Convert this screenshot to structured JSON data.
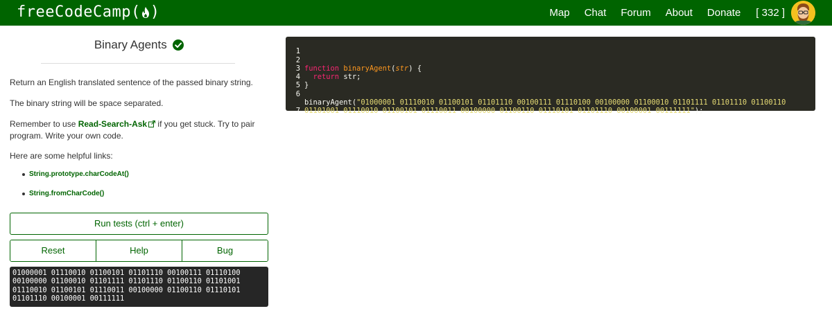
{
  "navbar": {
    "brand": "freeCodeCamp(",
    "brand_close": ")",
    "links": [
      "Map",
      "Chat",
      "Forum",
      "About",
      "Donate"
    ],
    "points": "[ 332 ]"
  },
  "challenge": {
    "title": "Binary Agents",
    "paragraphs": {
      "p1": "Return an English translated sentence of the passed binary string.",
      "p2": "The binary string will be space separated.",
      "p3_before": "Remember to use ",
      "p3_link": "Read-Search-Ask",
      "p3_after": " if you get stuck. Try to pair program. Write your own code.",
      "p4": "Here are some helpful links:"
    },
    "links": [
      "String.prototype.charCodeAt()",
      "String.fromCharCode()"
    ]
  },
  "buttons": {
    "run": "Run tests (ctrl + enter)",
    "reset": "Reset",
    "help": "Help",
    "bug": "Bug"
  },
  "output": {
    "lines": [
      "01000001 01110010 01100101 01101110 00100111 01110100",
      "00100000 01100010 01101111 01101110 01100110 01101001",
      "01110010 01100101 01110011 00100000 01100110 01110101",
      "01101110 00100001 00111111"
    ]
  },
  "editor": {
    "line_numbers": [
      "1",
      "2",
      "3",
      "4",
      "5",
      "6",
      "",
      "7"
    ],
    "line2": {
      "kw": "function",
      "fn": "binaryAgent",
      "open": "(",
      "param": "str",
      "close": ") {"
    },
    "line3": {
      "kw": "return",
      "rest": " str;"
    },
    "line4": "}",
    "line6_call": "binaryAgent(",
    "line6_str": "\"01000001 01110010 01100101 01101110 00100111 01110100 00100000 01100010 01101111 01101110 01100110",
    "line6b_str": "01101001 01110010 01100101 01110011 00100000 01100110 01110101 01101110 00100001 00111111\"",
    "line6_end": ");"
  },
  "colors": {
    "brand_green": "#006400",
    "editor_bg": "#2a2a23",
    "output_bg": "#262626"
  }
}
